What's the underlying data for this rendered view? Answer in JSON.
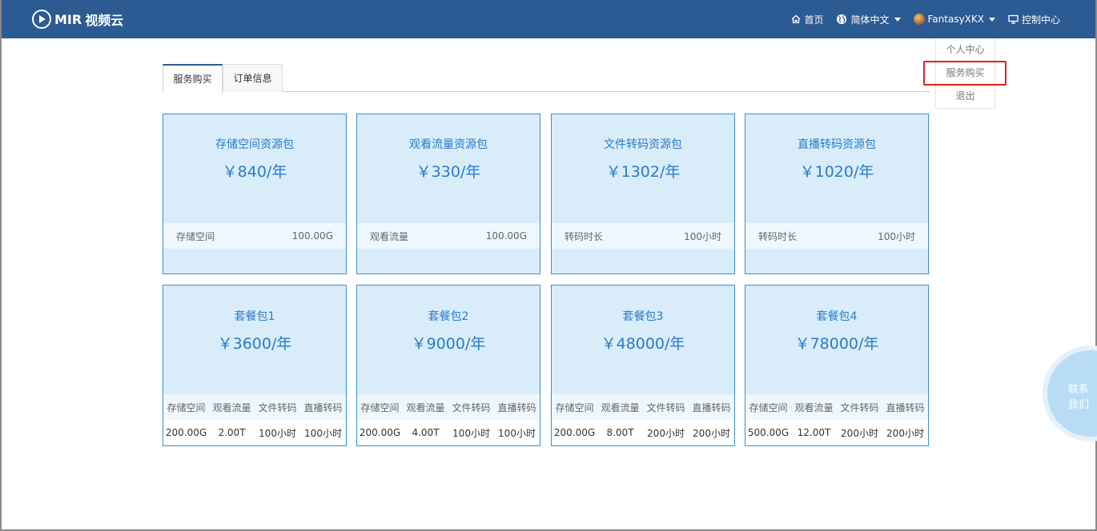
{
  "header": {
    "logo_text": "视频云",
    "logo_mark_text": "MIR",
    "nav": {
      "home": "首页",
      "language": "简体中文",
      "user": "FantasyXKX",
      "console": "控制中心"
    }
  },
  "user_menu": {
    "items": [
      "个人中心",
      "服务购买",
      "退出"
    ],
    "highlighted": "服务购买"
  },
  "tabs": [
    {
      "label": "服务购买",
      "active": true
    },
    {
      "label": "订单信息",
      "active": false
    }
  ],
  "resource_packs": [
    {
      "title": "存储空间资源包",
      "price": "￥840/年",
      "spec_label": "存储空间",
      "spec_value": "100.00G"
    },
    {
      "title": "观看流量资源包",
      "price": "￥330/年",
      "spec_label": "观看流量",
      "spec_value": "100.00G"
    },
    {
      "title": "文件转码资源包",
      "price": "￥1302/年",
      "spec_label": "转码时长",
      "spec_value": "100小时"
    },
    {
      "title": "直播转码资源包",
      "price": "￥1020/年",
      "spec_label": "转码时长",
      "spec_value": "100小时"
    }
  ],
  "bundle_columns": [
    "存储空间",
    "观看流量",
    "文件转码",
    "直播转码"
  ],
  "bundles": [
    {
      "title": "套餐包1",
      "price": "￥3600/年",
      "values": [
        "200.00G",
        "2.00T",
        "100小时",
        "100小时"
      ]
    },
    {
      "title": "套餐包2",
      "price": "￥9000/年",
      "values": [
        "200.00G",
        "4.00T",
        "100小时",
        "100小时"
      ]
    },
    {
      "title": "套餐包3",
      "price": "￥48000/年",
      "values": [
        "200.00G",
        "8.00T",
        "200小时",
        "200小时"
      ]
    },
    {
      "title": "套餐包4",
      "price": "￥78000/年",
      "values": [
        "500.00G",
        "12.00T",
        "200小时",
        "200小时"
      ]
    }
  ],
  "contact": {
    "line1": "联系",
    "line2": "我们"
  },
  "colors": {
    "header_bg": "#2c5a92",
    "card_bg": "#d8ecfa",
    "accent": "#2b7cc8",
    "highlight": "#e02020"
  }
}
